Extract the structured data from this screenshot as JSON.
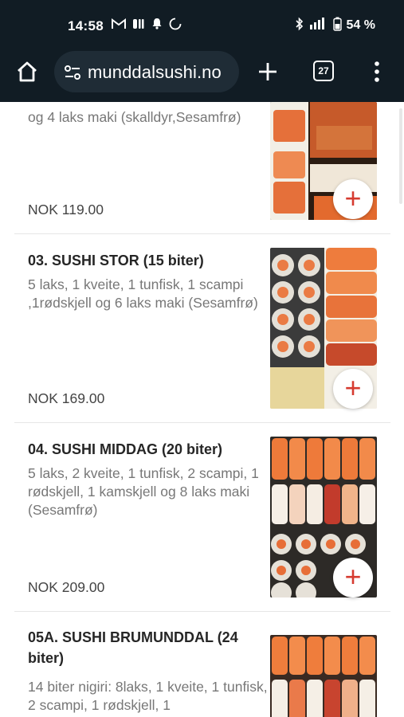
{
  "status_bar": {
    "time": "14:58",
    "battery_pct": "54 %",
    "left_icons": [
      "gmail-icon",
      "media-icon",
      "bell-icon",
      "sync-icon"
    ],
    "right_icons": [
      "bluetooth-icon",
      "signal-icon",
      "battery-icon"
    ]
  },
  "browser": {
    "url": "munddalsushi.no",
    "tab_count": "27",
    "icons": [
      "home-icon",
      "site-settings-icon",
      "new-tab-icon",
      "tabs-icon",
      "menu-icon"
    ]
  },
  "menu_items": [
    {
      "id": "02",
      "title": "",
      "description_tail": "og 4 laks maki (skalldyr,Sesamfrø)",
      "price": "NOK 119.00",
      "add_label": "+"
    },
    {
      "id": "03",
      "title": "03. SUSHI STOR (15 biter)",
      "description": "5 laks, 1 kveite, 1 tunfisk, 1 scampi ,1rødskjell og 6 laks maki (Sesamfrø)",
      "price": "NOK 169.00",
      "add_label": "+"
    },
    {
      "id": "04",
      "title": "04. SUSHI MIDDAG (20 biter)",
      "description": "5 laks, 2 kveite, 1 tunfisk, 2 scampi, 1 rødskjell, 1 kamskjell og 8 laks maki (Sesamfrø)",
      "price": "NOK 209.00",
      "add_label": "+"
    },
    {
      "id": "05A",
      "title": "05A. SUSHI BRUMUNDDAL (24 biter)",
      "description": "14 biter nigiri: 8laks, 1 kveite, 1 tunfisk, 2 scampi, 1 rødskjell, 1",
      "price": "",
      "add_label": ""
    }
  ],
  "colors": {
    "bar_bg": "#111c24",
    "url_pill_bg": "#1f2c36",
    "add_accent": "#d63b30",
    "title_text": "#262626",
    "desc_text": "#777777"
  }
}
